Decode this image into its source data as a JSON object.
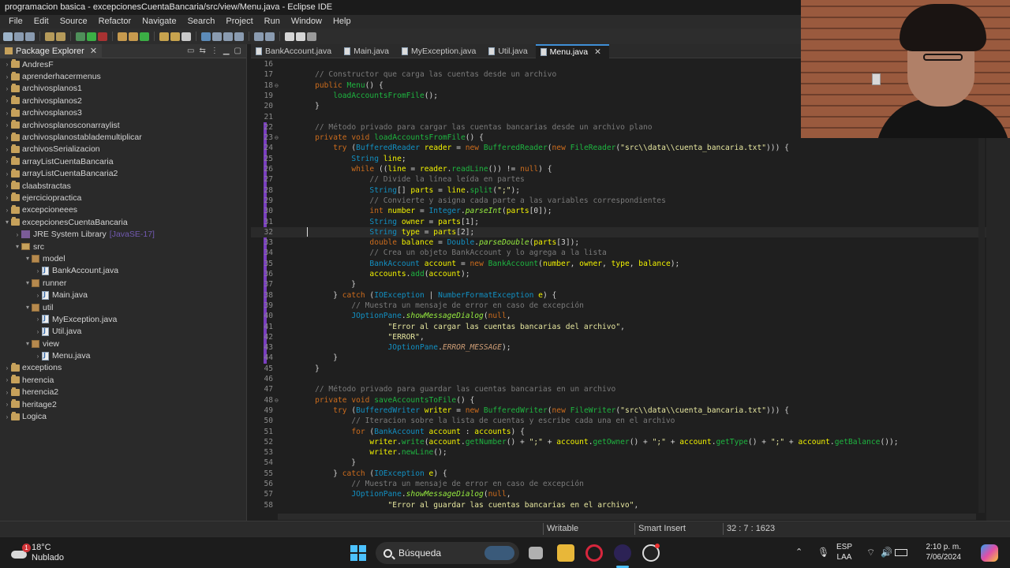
{
  "window": {
    "title": "programacion basica - excepcionesCuentaBancaria/src/view/Menu.java - Eclipse IDE"
  },
  "menu": [
    "File",
    "Edit",
    "Source",
    "Refactor",
    "Navigate",
    "Search",
    "Project",
    "Run",
    "Window",
    "Help"
  ],
  "explorer": {
    "title": "Package Explorer",
    "items": [
      {
        "label": "AndresF",
        "kind": "project",
        "depth": 0,
        "twisty": ">"
      },
      {
        "label": "aprenderhacermenus",
        "kind": "project",
        "depth": 0,
        "twisty": ">"
      },
      {
        "label": "archivosplanos1",
        "kind": "project",
        "depth": 0,
        "twisty": ">"
      },
      {
        "label": "archivosplanos2",
        "kind": "project",
        "depth": 0,
        "twisty": ">"
      },
      {
        "label": "archivosplanos3",
        "kind": "project",
        "depth": 0,
        "twisty": ">"
      },
      {
        "label": "archivosplanosconarraylist",
        "kind": "project",
        "depth": 0,
        "twisty": ">"
      },
      {
        "label": "archivosplanostablademultiplicar",
        "kind": "project",
        "depth": 0,
        "twisty": ">"
      },
      {
        "label": "archivosSerializacion",
        "kind": "project",
        "depth": 0,
        "twisty": ">"
      },
      {
        "label": "arrayListCuentaBancaria",
        "kind": "project",
        "depth": 0,
        "twisty": ">"
      },
      {
        "label": "arrayListCuentaBancaria2",
        "kind": "project",
        "depth": 0,
        "twisty": ">"
      },
      {
        "label": "claabstractas",
        "kind": "project",
        "depth": 0,
        "twisty": ">"
      },
      {
        "label": "ejerciciopractica",
        "kind": "project",
        "depth": 0,
        "twisty": ">"
      },
      {
        "label": "excepcioneees",
        "kind": "project",
        "depth": 0,
        "twisty": ">"
      },
      {
        "label": "excepcionesCuentaBancaria",
        "kind": "project",
        "depth": 0,
        "twisty": "v"
      },
      {
        "label": "JRE System Library",
        "kind": "lib",
        "depth": 1,
        "twisty": ">",
        "extra": "[JavaSE-17]"
      },
      {
        "label": "src",
        "kind": "src",
        "depth": 1,
        "twisty": "v"
      },
      {
        "label": "model",
        "kind": "pkg",
        "depth": 2,
        "twisty": "v"
      },
      {
        "label": "BankAccount.java",
        "kind": "java",
        "depth": 3,
        "twisty": ">"
      },
      {
        "label": "runner",
        "kind": "pkg",
        "depth": 2,
        "twisty": "v"
      },
      {
        "label": "Main.java",
        "kind": "java",
        "depth": 3,
        "twisty": ">"
      },
      {
        "label": "util",
        "kind": "pkg",
        "depth": 2,
        "twisty": "v"
      },
      {
        "label": "MyException.java",
        "kind": "java",
        "depth": 3,
        "twisty": ">"
      },
      {
        "label": "Util.java",
        "kind": "java",
        "depth": 3,
        "twisty": ">"
      },
      {
        "label": "view",
        "kind": "pkg",
        "depth": 2,
        "twisty": "v"
      },
      {
        "label": "Menu.java",
        "kind": "java",
        "depth": 3,
        "twisty": ">"
      },
      {
        "label": "exceptions",
        "kind": "project",
        "depth": 0,
        "twisty": ">"
      },
      {
        "label": "herencia",
        "kind": "project",
        "depth": 0,
        "twisty": ">"
      },
      {
        "label": "herencia2",
        "kind": "project",
        "depth": 0,
        "twisty": ">"
      },
      {
        "label": "heritage2",
        "kind": "project",
        "depth": 0,
        "twisty": ">"
      },
      {
        "label": "Logica",
        "kind": "project",
        "depth": 0,
        "twisty": ">"
      }
    ]
  },
  "tabs": [
    {
      "label": "BankAccount.java",
      "active": false
    },
    {
      "label": "Main.java",
      "active": false
    },
    {
      "label": "MyException.java",
      "active": false
    },
    {
      "label": "Util.java",
      "active": false
    },
    {
      "label": "Menu.java",
      "active": true
    }
  ],
  "code": {
    "current_line": 32,
    "lines": [
      {
        "n": "16",
        "h": ""
      },
      {
        "n": "17",
        "h": "    <span class='c'>// Constructor que carga las cuentas desde un archivo</span>"
      },
      {
        "n": "18",
        "h": "    <span class='k'>public</span> <span class='m'>Menu</span>() {",
        "fold": true
      },
      {
        "n": "19",
        "h": "        <span class='m'>loadAccountsFromFile</span>();"
      },
      {
        "n": "20",
        "h": "    }"
      },
      {
        "n": "21",
        "h": ""
      },
      {
        "n": "22",
        "h": "    <span class='c'>// Método privado para cargar las cuentas bancarias desde un archivo plano</span>"
      },
      {
        "n": "23",
        "h": "    <span class='k'>private</span> <span class='k'>void</span> <span class='m'>loadAccountsFromFile</span>() {",
        "fold": true
      },
      {
        "n": "24",
        "h": "        <span class='k'>try</span> (<span class='t'>BufferedReader</span> <span class='v'>reader</span> = <span class='k'>new</span> <span class='m'>BufferedReader</span>(<span class='k'>new</span> <span class='m'>FileReader</span>(<span class='s'>\"src\\\\data\\\\cuenta_bancaria.txt\"</span>))) {"
      },
      {
        "n": "25",
        "h": "            <span class='t'>String</span> <span class='v'>line</span>;"
      },
      {
        "n": "26",
        "h": "            <span class='k'>while</span> ((<span class='v'>line</span> = <span class='v'>reader</span>.<span class='m'>readLine</span>()) != <span class='k'>null</span>) {"
      },
      {
        "n": "27",
        "h": "                <span class='c'>// Divide la línea leída en partes</span>"
      },
      {
        "n": "28",
        "h": "                <span class='t'>String</span>[] <span class='v'>parts</span> = <span class='v'>line</span>.<span class='m'>split</span>(<span class='s'>\";\"</span>);"
      },
      {
        "n": "29",
        "h": "                <span class='c'>// Convierte y asigna cada parte a las variables correspondientes</span>"
      },
      {
        "n": "30",
        "h": "                <span class='k'>int</span> <span class='v'>number</span> = <span class='t'>Integer</span>.<span class='i'>parseInt</span>(<span class='v'>parts</span>[0]);"
      },
      {
        "n": "31",
        "h": "                <span class='t'>String</span> <span class='v'>owner</span> = <span class='v'>parts</span>[1];"
      },
      {
        "n": "32",
        "h": "                <span class='t'>String</span> <span class='v'>type</span> = <span class='v'>parts</span>[2];"
      },
      {
        "n": "33",
        "h": "                <span class='k'>double</span> <span class='v'>balance</span> = <span class='t'>Double</span>.<span class='i'>parseDouble</span>(<span class='v'>parts</span>[3]);"
      },
      {
        "n": "34",
        "h": "                <span class='c'>// Crea un objeto BankAccount y lo agrega a la lista</span>"
      },
      {
        "n": "35",
        "h": "                <span class='t'>BankAccount</span> <span class='v'>account</span> = <span class='k'>new</span> <span class='m'>BankAccount</span>(<span class='v'>number</span>, <span class='v'>owner</span>, <span class='v'>type</span>, <span class='v'>balance</span>);"
      },
      {
        "n": "36",
        "h": "                <span class='v'>accounts</span>.<span class='m'>add</span>(<span class='v'>account</span>);"
      },
      {
        "n": "37",
        "h": "            }"
      },
      {
        "n": "38",
        "h": "        } <span class='k'>catch</span> (<span class='t'>IOException</span> | <span class='t'>NumberFormatException</span> <span class='v'>e</span>) {"
      },
      {
        "n": "39",
        "h": "            <span class='c'>// Muestra un mensaje de error en caso de excepción</span>"
      },
      {
        "n": "40",
        "h": "            <span class='t'>JOptionPane</span>.<span class='i'>showMessageDialog</span>(<span class='k'>null</span>,"
      },
      {
        "n": "41",
        "h": "                    <span class='s'>\"Error al cargar las cuentas bancarias del archivo\"</span>,"
      },
      {
        "n": "42",
        "h": "                    <span class='s'>\"ERROR\"</span>,"
      },
      {
        "n": "43",
        "h": "                    <span class='t'>JOptionPane</span>.<span class='tcst'>ERROR_MESSAGE</span>);"
      },
      {
        "n": "44",
        "h": "        }"
      },
      {
        "n": "45",
        "h": "    }"
      },
      {
        "n": "46",
        "h": ""
      },
      {
        "n": "47",
        "h": "    <span class='c'>// Método privado para guardar las cuentas bancarias en un archivo</span>"
      },
      {
        "n": "48",
        "h": "    <span class='k'>private</span> <span class='k'>void</span> <span class='m'>saveAccountsToFile</span>() {",
        "fold": true
      },
      {
        "n": "49",
        "h": "        <span class='k'>try</span> (<span class='t'>BufferedWriter</span> <span class='v'>writer</span> = <span class='k'>new</span> <span class='m'>BufferedWriter</span>(<span class='k'>new</span> <span class='m'>FileWriter</span>(<span class='s'>\"src\\\\data\\\\cuenta_bancaria.txt\"</span>))) {"
      },
      {
        "n": "50",
        "h": "            <span class='c'>// Iteracion sobre la lista de cuentas y escribe cada una en el archivo</span>"
      },
      {
        "n": "51",
        "h": "            <span class='k'>for</span> (<span class='t'>BankAccount</span> <span class='v'>account</span> : <span class='v'>accounts</span>) {"
      },
      {
        "n": "52",
        "h": "                <span class='v'>writer</span>.<span class='m'>write</span>(<span class='v'>account</span>.<span class='m'>getNumber</span>() + <span class='s'>\";\"</span> + <span class='v'>account</span>.<span class='m'>getOwner</span>() + <span class='s'>\";\"</span> + <span class='v'>account</span>.<span class='m'>getType</span>() + <span class='s'>\";\"</span> + <span class='v'>account</span>.<span class='m'>getBalance</span>());"
      },
      {
        "n": "53",
        "h": "                <span class='v'>writer</span>.<span class='m'>newLine</span>();"
      },
      {
        "n": "54",
        "h": "            }"
      },
      {
        "n": "55",
        "h": "        } <span class='k'>catch</span> (<span class='t'>IOException</span> <span class='v'>e</span>) {"
      },
      {
        "n": "56",
        "h": "            <span class='c'>// Muestra un mensaje de error en caso de excepción</span>"
      },
      {
        "n": "57",
        "h": "            <span class='t'>JOptionPane</span>.<span class='i'>showMessageDialog</span>(<span class='k'>null</span>,"
      },
      {
        "n": "58",
        "h": "                    <span class='s'>\"Error al guardar las cuentas bancarias en el archivo\"</span>,"
      }
    ]
  },
  "status": {
    "writable": "Writable",
    "insert_mode": "Smart Insert",
    "position": "32 : 7 : 1623"
  },
  "taskbar": {
    "temperature": "18°C",
    "weather": "Nublado",
    "weather_badge": "1",
    "search_label": "Búsqueda",
    "lang_top": "ESP",
    "lang_bottom": "LAA",
    "time": "2:10 p. m.",
    "date": "7/06/2024"
  },
  "icons": {
    "close": "close-icon",
    "search": "search-icon",
    "windows": "windows-start-icon"
  }
}
